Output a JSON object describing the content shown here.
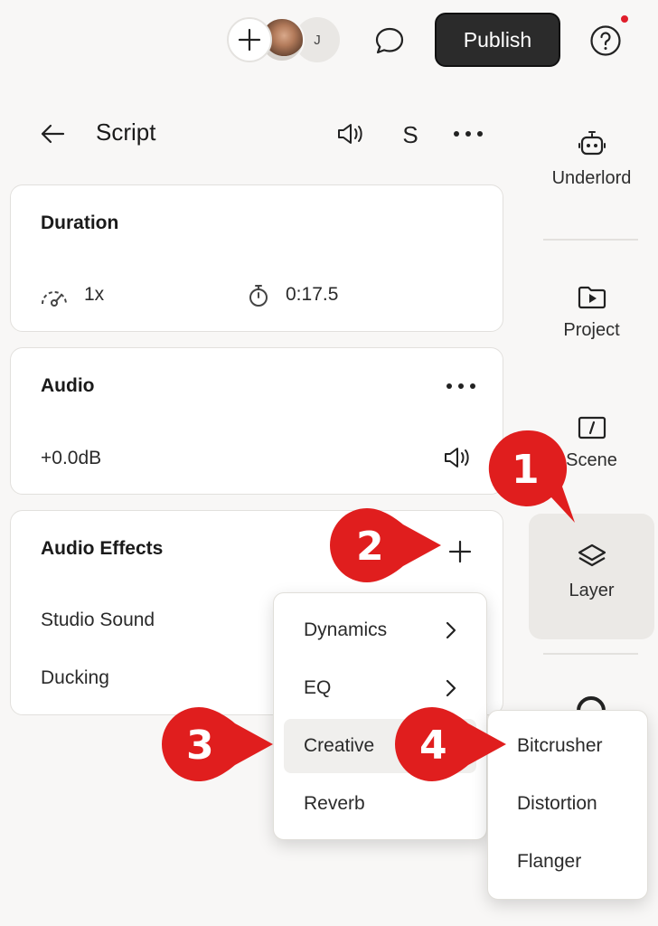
{
  "topbar": {
    "avatar_initial": "J",
    "publish_label": "Publish"
  },
  "header": {
    "title": "Script",
    "solo_label": "S"
  },
  "duration_card": {
    "title": "Duration",
    "speed": "1x",
    "time": "0:17.5"
  },
  "audio_card": {
    "title": "Audio",
    "gain": "+0.0dB"
  },
  "effects_card": {
    "title": "Audio Effects",
    "items": [
      "Studio Sound",
      "Ducking"
    ]
  },
  "sidebar": {
    "items": [
      {
        "label": "Underlord",
        "icon": "robot-icon"
      },
      {
        "label": "Project",
        "icon": "folder-play-icon"
      },
      {
        "label": "Scene",
        "icon": "scene-icon"
      },
      {
        "label": "Layer",
        "icon": "layers-icon"
      }
    ]
  },
  "effects_menu": {
    "items": [
      "Dynamics",
      "EQ",
      "Creative",
      "Reverb"
    ],
    "highlighted": "Creative"
  },
  "creative_submenu": {
    "items": [
      "Bitcrusher",
      "Distortion",
      "Flanger"
    ]
  },
  "callouts": [
    "1",
    "2",
    "3",
    "4"
  ],
  "colors": {
    "accent_red": "#e01e1e",
    "publish_bg": "#2b2b2b",
    "background": "#f8f7f6"
  }
}
